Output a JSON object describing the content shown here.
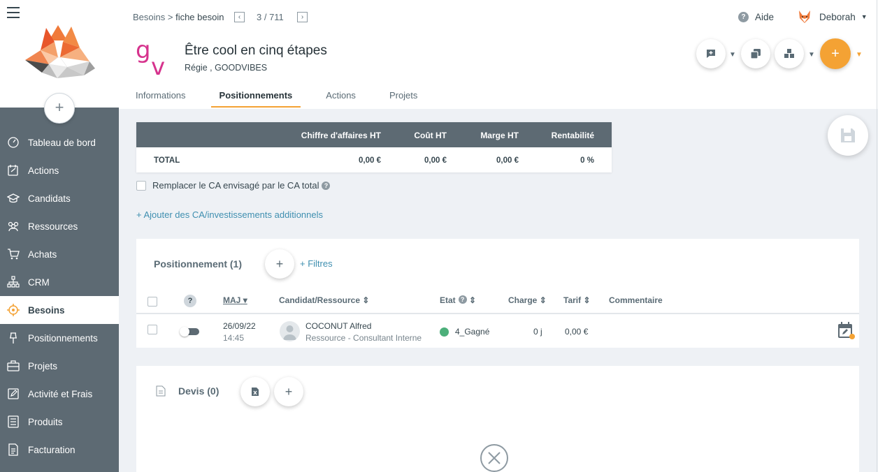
{
  "colors": {
    "sidebar": "#5d6a73",
    "accent": "#f4a234",
    "link": "#3f8fb0",
    "success": "#4caf7a",
    "brand": "#d6338d"
  },
  "sidebar": {
    "menu_icon": "hamburger-icon",
    "add_icon": "+",
    "items": [
      {
        "label": "Tableau de bord",
        "icon": "dashboard-icon"
      },
      {
        "label": "Actions",
        "icon": "actions-icon"
      },
      {
        "label": "Candidats",
        "icon": "graduation-cap-icon"
      },
      {
        "label": "Ressources",
        "icon": "people-icon"
      },
      {
        "label": "Achats",
        "icon": "cart-icon"
      },
      {
        "label": "CRM",
        "icon": "sitemap-icon"
      },
      {
        "label": "Besoins",
        "icon": "target-icon",
        "active": true
      },
      {
        "label": "Positionnements",
        "icon": "pin-icon"
      },
      {
        "label": "Projets",
        "icon": "briefcase-icon"
      },
      {
        "label": "Activité et Frais",
        "icon": "edit-icon"
      },
      {
        "label": "Produits",
        "icon": "list-icon"
      },
      {
        "label": "Facturation",
        "icon": "invoice-icon"
      }
    ]
  },
  "header": {
    "breadcrumb_root": "Besoins",
    "breadcrumb_sep": " > ",
    "breadcrumb_current": "fiche besoin",
    "pager_prev": "‹",
    "pager_text": "3 / 711",
    "pager_next": "›",
    "help_icon": "?",
    "help_label": "Aide",
    "user_name": "Deborah",
    "user_caret": "▼",
    "title": "Être cool en cinq étapes",
    "subtitle": "Régie , GOODVIBES",
    "caret": "▼",
    "add_label": "+"
  },
  "tabs": [
    {
      "label": "Informations"
    },
    {
      "label": "Positionnements",
      "active": true
    },
    {
      "label": "Actions"
    },
    {
      "label": "Projets"
    }
  ],
  "summary": {
    "headers": [
      "Chiffre d'affaires HT",
      "Coût HT",
      "Marge HT",
      "Rentabilité"
    ],
    "row_label": "TOTAL",
    "values": [
      "0,00 €",
      "0,00 €",
      "0,00 €",
      "0 %"
    ]
  },
  "options": {
    "replace_ca_label": "Remplacer le CA envisagé par le CA total",
    "help_icon": "?",
    "add_ca_label": "+ Ajouter des CA/investissements additionnels"
  },
  "positionnement": {
    "title": "Positionnement (1)",
    "add_label": "+",
    "filter_label": "+ Filtres",
    "help_icon": "?",
    "columns": {
      "maj": "MAJ",
      "candidat": "Candidat/Ressource",
      "etat": "Etat",
      "charge": "Charge",
      "tarif": "Tarif",
      "commentaire": "Commentaire"
    },
    "sort_desc": "▾",
    "sort_both": "⇕",
    "rows": [
      {
        "date": "26/09/22",
        "time": "14:45",
        "name": "COCONUT Alfred",
        "role": "Ressource - Consultant Interne",
        "etat": "4_Gagné",
        "charge": "0 j",
        "tarif": "0,00 €",
        "commentaire": ""
      }
    ]
  },
  "devis": {
    "title": "Devis (0)",
    "add_label": "+"
  }
}
